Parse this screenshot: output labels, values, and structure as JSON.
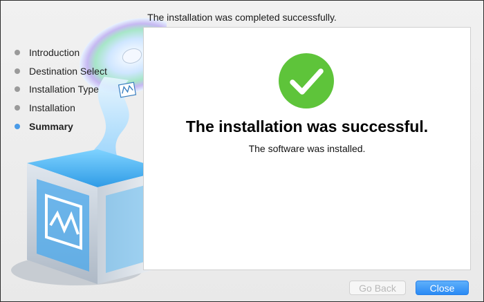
{
  "header": {
    "title": "The installation was completed successfully."
  },
  "steps": [
    {
      "label": "Introduction",
      "active": false
    },
    {
      "label": "Destination Select",
      "active": false
    },
    {
      "label": "Installation Type",
      "active": false
    },
    {
      "label": "Installation",
      "active": false
    },
    {
      "label": "Summary",
      "active": true
    }
  ],
  "content": {
    "icon": "checkmark-circle-icon",
    "title": "The installation was successful.",
    "subtitle": "The software was installed."
  },
  "buttons": {
    "back_label": "Go Back",
    "back_enabled": false,
    "close_label": "Close"
  },
  "colors": {
    "success_green": "#5ec43a",
    "accent_blue": "#3d95f0",
    "inactive_dot": "#9a9a9a"
  }
}
